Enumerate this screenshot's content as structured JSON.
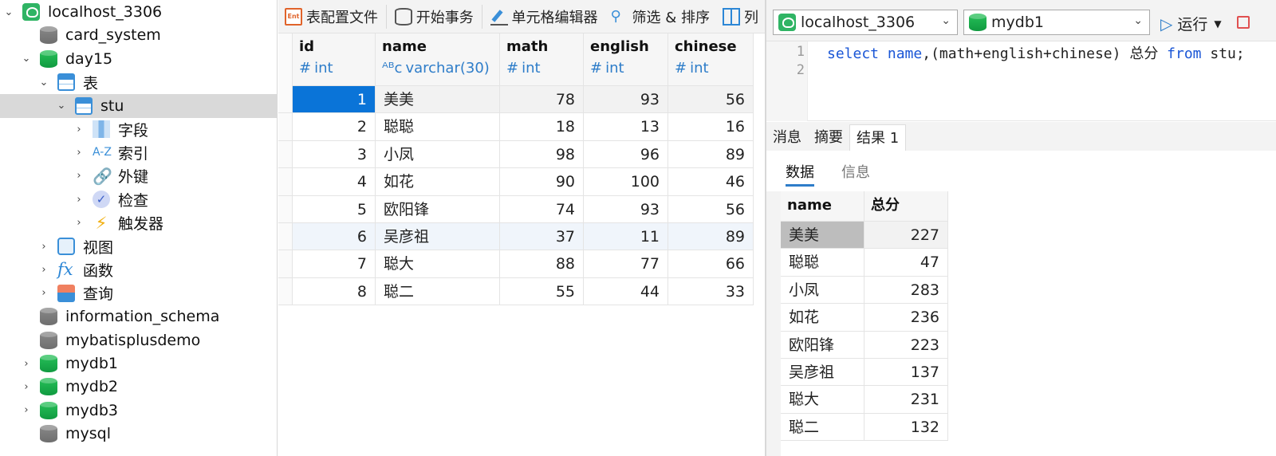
{
  "tree": {
    "items": [
      {
        "label": "localhost_3306",
        "icon": "connection-icon",
        "chevron": "open",
        "indent": 0
      },
      {
        "label": "card_system",
        "icon": "database-gray-icon",
        "chevron": "none",
        "indent": 1
      },
      {
        "label": "day15",
        "icon": "database-green-icon",
        "chevron": "open",
        "indent": 1
      },
      {
        "label": "表",
        "icon": "table-folder-icon",
        "chevron": "open",
        "indent": 2
      },
      {
        "label": "stu",
        "icon": "table-icon",
        "chevron": "open",
        "indent": 3,
        "selected": true
      },
      {
        "label": "字段",
        "icon": "fields-icon",
        "chevron": "closed",
        "indent": 4
      },
      {
        "label": "索引",
        "icon": "index-icon",
        "chevron": "closed",
        "indent": 4
      },
      {
        "label": "外键",
        "icon": "foreign-key-icon",
        "chevron": "closed",
        "indent": 4
      },
      {
        "label": "检查",
        "icon": "check-icon",
        "chevron": "closed",
        "indent": 4
      },
      {
        "label": "触发器",
        "icon": "trigger-icon",
        "chevron": "closed",
        "indent": 4
      },
      {
        "label": "视图",
        "icon": "view-icon",
        "chevron": "closed",
        "indent": 2
      },
      {
        "label": "函数",
        "icon": "function-icon",
        "chevron": "closed",
        "indent": 2
      },
      {
        "label": "查询",
        "icon": "query-icon",
        "chevron": "closed",
        "indent": 2
      },
      {
        "label": "information_schema",
        "icon": "database-gray-icon",
        "chevron": "none",
        "indent": 1
      },
      {
        "label": "mybatisplusdemo",
        "icon": "database-gray-icon",
        "chevron": "none",
        "indent": 1
      },
      {
        "label": "mydb1",
        "icon": "database-green-icon",
        "chevron": "closed",
        "indent": 1
      },
      {
        "label": "mydb2",
        "icon": "database-green-icon",
        "chevron": "closed",
        "indent": 1
      },
      {
        "label": "mydb3",
        "icon": "database-green-icon",
        "chevron": "closed",
        "indent": 1
      },
      {
        "label": "mysql",
        "icon": "database-gray-icon",
        "chevron": "none",
        "indent": 1
      }
    ]
  },
  "toolbar": {
    "table_config": "表配置文件",
    "begin_tx": "开始事务",
    "cell_editor": "单元格编辑器",
    "filter_sort": "筛选 & 排序",
    "columns_partial": "列"
  },
  "grid": {
    "columns": [
      {
        "name": "id",
        "type": "int",
        "type_icon": "hash-icon",
        "align": "num"
      },
      {
        "name": "name",
        "type": "varchar(30)",
        "type_icon": "abc-icon",
        "align": "txt"
      },
      {
        "name": "math",
        "type": "int",
        "type_icon": "hash-icon",
        "align": "num"
      },
      {
        "name": "english",
        "type": "int",
        "type_icon": "hash-icon",
        "align": "num"
      },
      {
        "name": "chinese",
        "type": "int",
        "type_icon": "hash-icon",
        "align": "num"
      }
    ],
    "rows": [
      [
        "1",
        "美美",
        "78",
        "93",
        "56"
      ],
      [
        "2",
        "聪聪",
        "18",
        "13",
        "16"
      ],
      [
        "3",
        "小凤",
        "98",
        "96",
        "89"
      ],
      [
        "4",
        "如花",
        "90",
        "100",
        "46"
      ],
      [
        "5",
        "欧阳锋",
        "74",
        "93",
        "56"
      ],
      [
        "6",
        "吴彦祖",
        "37",
        "11",
        "89"
      ],
      [
        "7",
        "聪大",
        "88",
        "77",
        "66"
      ],
      [
        "8",
        "聪二",
        "55",
        "44",
        "33"
      ]
    ]
  },
  "query": {
    "connection": "localhost_3306",
    "database": "mydb1",
    "run_label": "运行",
    "line_numbers": [
      "1",
      "2"
    ],
    "sql": {
      "kw_select": "select",
      "col_name": "name",
      "expr": ",(math+english+chinese) 总分 ",
      "kw_from": "from",
      "tail": " stu;"
    }
  },
  "result_tabs": [
    "消息",
    "摘要",
    "结果 1"
  ],
  "result_subtabs": {
    "data": "数据",
    "info": "信息"
  },
  "result": {
    "columns": [
      "name",
      "总分"
    ],
    "rows": [
      [
        "美美",
        "227"
      ],
      [
        "聪聪",
        "47"
      ],
      [
        "小凤",
        "283"
      ],
      [
        "如花",
        "236"
      ],
      [
        "欧阳锋",
        "223"
      ],
      [
        "吴彦祖",
        "137"
      ],
      [
        "聪大",
        "231"
      ],
      [
        "聪二",
        "132"
      ]
    ]
  },
  "colors": {
    "selection": "#0a74d8",
    "accent": "#2e7dc9",
    "db_green": "#1aa84c"
  }
}
